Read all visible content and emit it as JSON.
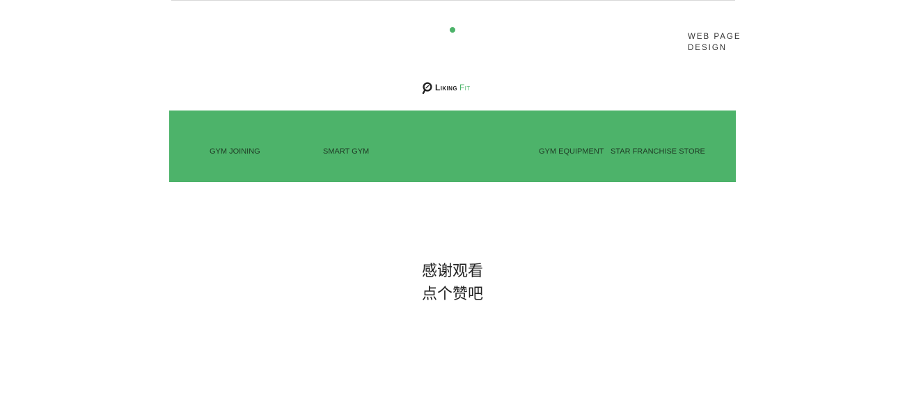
{
  "header": {
    "caption_line1": "WEB PAGE",
    "caption_line2": "DESIGN"
  },
  "logo": {
    "word1": "Liking",
    "word2": "Fit",
    "icon": "liking-fit-logo-icon"
  },
  "nav": {
    "items": [
      {
        "label": "GYM JOINING"
      },
      {
        "label": "SMART GYM"
      },
      {
        "label": "GYM EQUIPMENT"
      },
      {
        "label": "STAR FRANCHISE STORE"
      }
    ]
  },
  "closing": {
    "line1": "感谢观看",
    "line2": "点个赞吧"
  },
  "colors": {
    "brand_green": "#4db36a",
    "text_dark": "#222222"
  }
}
